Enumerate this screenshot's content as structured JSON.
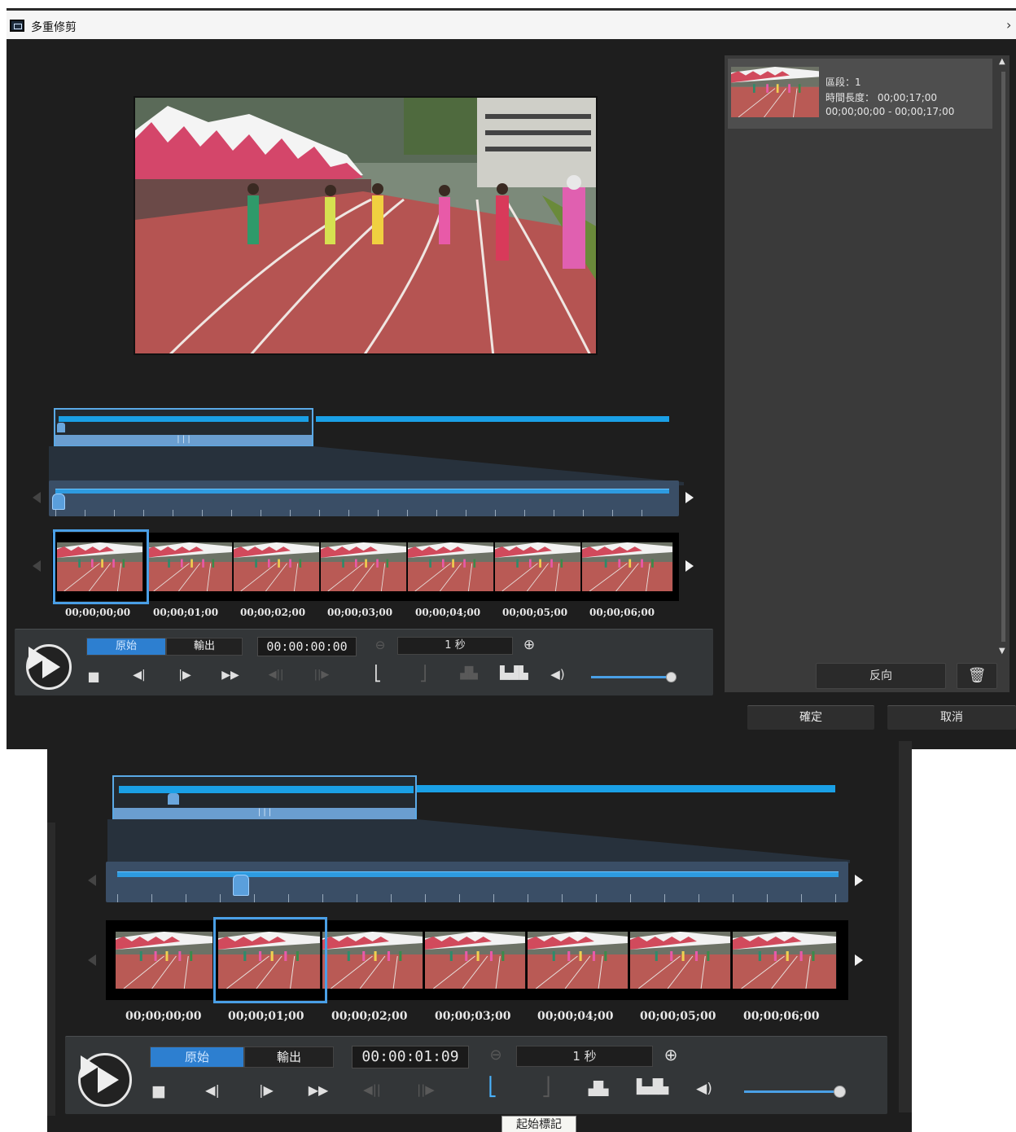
{
  "window": {
    "title": "多重修剪"
  },
  "preview": {
    "scene": "track-and-field"
  },
  "timecodes": [
    "00;00;00;00",
    "00;00;01;00",
    "00;00;02;00",
    "00;00;03;00",
    "00;00;04;00",
    "00;00;05;00",
    "00;00;06;00"
  ],
  "controls_top": {
    "mode_original": "原始",
    "mode_output": "輸出",
    "timecode": "00:00:00:00",
    "zoom_interval": "1 秒"
  },
  "controls_bottom": {
    "mode_original": "原始",
    "mode_output": "輸出",
    "timecode": "00:00:01:09",
    "zoom_interval": "1 秒",
    "tooltip": "起始標記"
  },
  "clip": {
    "line1": "區段：1",
    "line2": "時間長度： 00;00;17;00",
    "line3": "00;00;00;00 - 00;00;17;00"
  },
  "side": {
    "reverse_label": "反向"
  },
  "footer": {
    "ok_label": "確定",
    "cancel_label": "取消"
  },
  "colors": {
    "accent": "#1aa0e6",
    "selection": "#4a9fe6",
    "track": "#b5504e"
  }
}
